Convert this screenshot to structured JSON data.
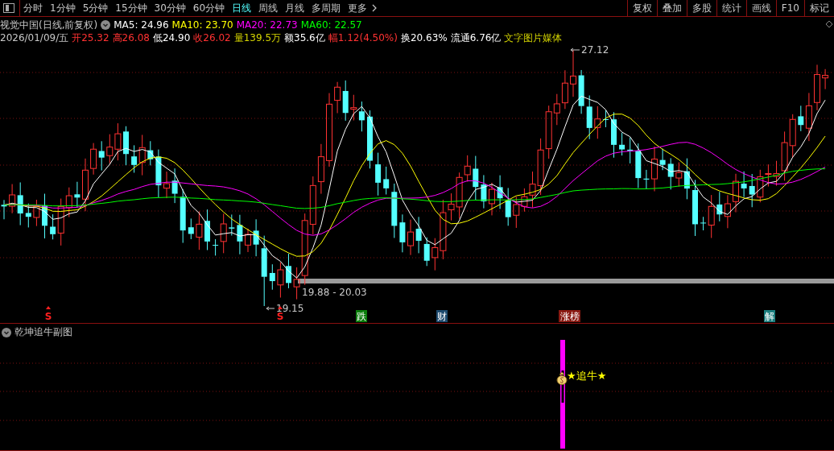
{
  "toolbar": {
    "tabs": [
      {
        "label": "分时",
        "selected": false
      },
      {
        "label": "1分钟",
        "selected": false
      },
      {
        "label": "5分钟",
        "selected": false
      },
      {
        "label": "15分钟",
        "selected": false
      },
      {
        "label": "30分钟",
        "selected": false
      },
      {
        "label": "60分钟",
        "selected": false
      },
      {
        "label": "日线",
        "selected": true
      },
      {
        "label": "周线",
        "selected": false
      },
      {
        "label": "月线",
        "selected": false
      },
      {
        "label": "多周期",
        "selected": false
      },
      {
        "label": "更多",
        "selected": false
      }
    ],
    "buttons": [
      "复权",
      "叠加",
      "多股",
      "统计",
      "画线",
      "F10",
      "标记"
    ]
  },
  "quote": {
    "title": "视觉中国(日线,前复权)",
    "moving_averages": [
      {
        "label": "MA5: 24.96",
        "color": "#ffffff"
      },
      {
        "label": "MA10: 23.70",
        "color": "#ffff00"
      },
      {
        "label": "MA20: 22.73",
        "color": "#ff00ff"
      },
      {
        "label": "MA60: 22.57",
        "color": "#00ff00"
      }
    ],
    "date": "2026/01/09/五",
    "fields": [
      {
        "text": "开25.32",
        "color": "#ff3232"
      },
      {
        "text": "高26.08",
        "color": "#ff3232"
      },
      {
        "text": "低24.90",
        "color": "#ffffff"
      },
      {
        "text": "收26.02",
        "color": "#ff3232"
      },
      {
        "text": "量139.5万",
        "color": "#d4d400"
      },
      {
        "text": "额35.6亿",
        "color": "#ffffff"
      },
      {
        "text": "幅1.12(4.50%)",
        "color": "#ff3232"
      },
      {
        "text": "换20.63%",
        "color": "#ffffff"
      },
      {
        "text": "流通6.76亿",
        "color": "#ffffff"
      },
      {
        "text": "文字图片媒体",
        "color": "#d4d400"
      }
    ]
  },
  "main_chart": {
    "price_labels": [
      {
        "kind": "high",
        "text": "27.12"
      },
      {
        "kind": "range",
        "text": "19.88 - 20.03"
      },
      {
        "kind": "low",
        "text": "19.15"
      }
    ],
    "markers": [
      {
        "kind": "signal",
        "text": "S",
        "color": "#ff2020"
      },
      {
        "kind": "signal",
        "text": "S",
        "color": "#ff2020"
      },
      {
        "kind": "event",
        "text": "跌",
        "color": "#0b7d0b"
      },
      {
        "kind": "event",
        "text": "财",
        "color": "#1c4a6e"
      },
      {
        "kind": "event",
        "text": "涨榜",
        "color": "#8a1a12"
      },
      {
        "kind": "event",
        "text": "解",
        "color": "#1a7e7e"
      }
    ]
  },
  "sub_chart": {
    "title": "乾坤追牛副图",
    "signal_text": "★追牛★"
  }
}
